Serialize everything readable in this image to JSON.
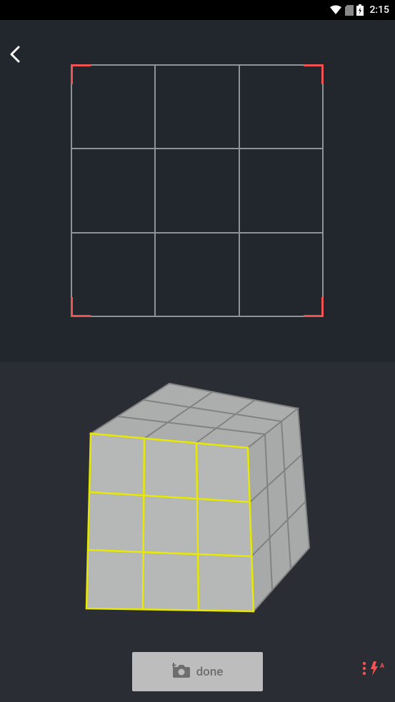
{
  "status": {
    "time": "2:15"
  },
  "colors": {
    "accent_red": "#f05353",
    "grid_gray": "#8f9296",
    "cube_face": "#b6b7b7",
    "cube_edge_dark": "#828282",
    "cube_edge_highlight": "#e7e900",
    "panel_top": "#22272e",
    "panel_bottom": "#2a2e34",
    "button_bg": "#bdbdbd",
    "button_text": "#6e6e6e"
  },
  "capture_grid": {
    "size": 3,
    "corners_highlighted": true
  },
  "cube": {
    "dimensions": "3x3x3",
    "highlighted_face": "front"
  },
  "actions": {
    "done_label": "done"
  }
}
